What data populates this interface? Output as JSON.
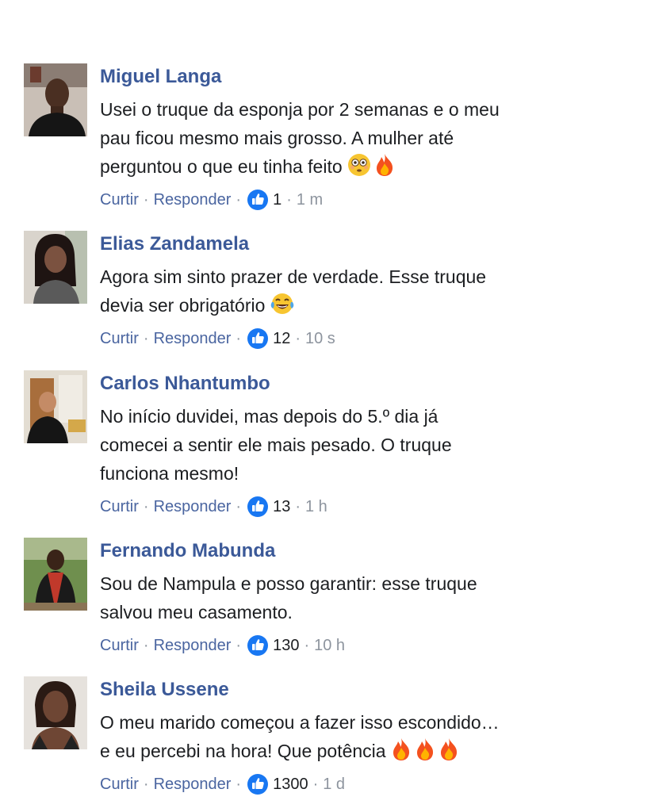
{
  "comments": [
    {
      "author": "Miguel Langa",
      "line1": "Usei o truque da esponja por 2 semanas e o meu",
      "line2": "pau ficou mesmo mais grosso. A mulher até",
      "line3": "perguntou o que eu tinha feito",
      "emojis": [
        "flushed-face",
        "fire"
      ],
      "like_label": "Curtir",
      "reply_label": "Responder",
      "likes": "1",
      "time": "1 m"
    },
    {
      "author": "Elias Zandamela",
      "line1": "Agora sim sinto prazer de verdade. Esse truque",
      "line2": "devia ser obrigatório",
      "line3": "",
      "emojis": [
        "tears-of-joy"
      ],
      "like_label": "Curtir",
      "reply_label": "Responder",
      "likes": "12",
      "time": "10 s"
    },
    {
      "author": "Carlos Nhantumbo",
      "line1": "No início duvidei, mas depois do 5.º dia já",
      "line2": "comecei a sentir ele mais pesado. O truque",
      "line3": "funciona mesmo!",
      "emojis": [],
      "like_label": "Curtir",
      "reply_label": "Responder",
      "likes": "13",
      "time": "1 h"
    },
    {
      "author": "Fernando Mabunda",
      "line1": "Sou de Nampula e posso garantir: esse truque",
      "line2": "salvou meu casamento.",
      "line3": "",
      "emojis": [],
      "like_label": "Curtir",
      "reply_label": "Responder",
      "likes": "130",
      "time": "10 h"
    },
    {
      "author": "Sheila Ussene",
      "line1": "O meu marido começou a fazer isso escondido…",
      "line2": "e eu percebi na hora! Que potência",
      "line3": "",
      "emojis": [
        "fire",
        "fire",
        "fire"
      ],
      "like_label": "Curtir",
      "reply_label": "Responder",
      "likes": "1300",
      "time": "1 d"
    }
  ],
  "colors": {
    "author": "#3b5998",
    "link": "#4a65a0",
    "meta": "#8d949e",
    "text": "#1c1e21",
    "like_badge": "#1877f2"
  }
}
